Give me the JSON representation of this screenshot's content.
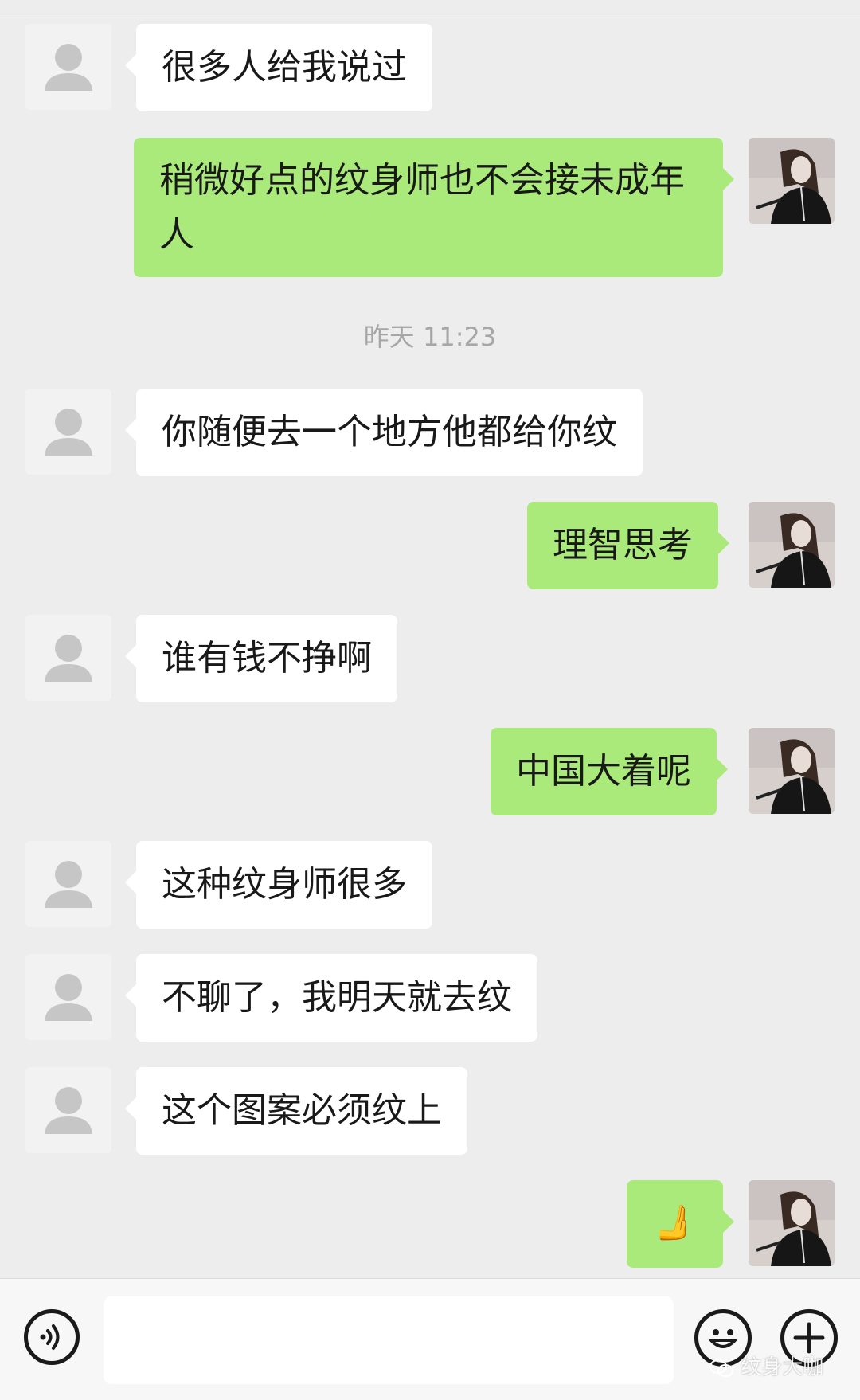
{
  "chat": {
    "timestamp": "昨天 11:23",
    "messages": [
      {
        "side": "in",
        "text": "很多人给我说过"
      },
      {
        "side": "out",
        "text": "稍微好点的纹身师也不会接未成年人"
      },
      {
        "side": "in",
        "text": "你随便去一个地方他都给你纹"
      },
      {
        "side": "out",
        "text": "理智思考"
      },
      {
        "side": "in",
        "text": "谁有钱不挣啊"
      },
      {
        "side": "out",
        "text": "中国大着呢"
      },
      {
        "side": "in",
        "text": "这种纹身师很多"
      },
      {
        "side": "in",
        "text": "不聊了，我明天就去纹"
      },
      {
        "side": "in",
        "text": "这个图案必须纹上"
      },
      {
        "side": "out",
        "text": "🫸"
      }
    ]
  },
  "input_bar": {
    "voice_icon": "voice-icon",
    "text_value": "",
    "emoji_icon": "emoji-icon",
    "plus_icon": "plus-icon"
  },
  "watermark": {
    "text": "纹身大咖"
  },
  "colors": {
    "background": "#ededed",
    "incoming_bubble": "#ffffff",
    "outgoing_bubble": "#a9ea7a",
    "timestamp": "#a6a6a6"
  }
}
